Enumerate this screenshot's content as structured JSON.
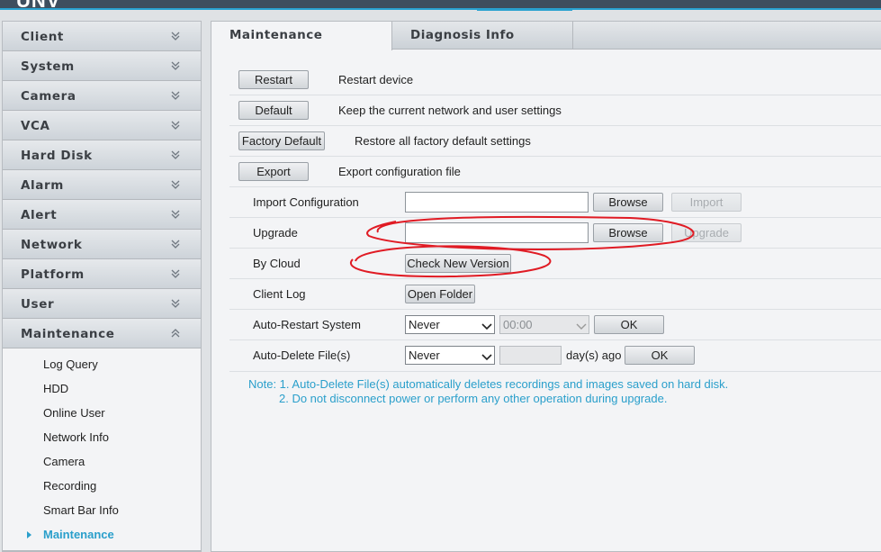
{
  "header": {
    "logo": "UNV",
    "accent_color": "#29a1cf",
    "bar_color": "#3e4e5e"
  },
  "sidebar": {
    "menus": [
      {
        "label": "Client",
        "expanded": false
      },
      {
        "label": "System",
        "expanded": false
      },
      {
        "label": "Camera",
        "expanded": false
      },
      {
        "label": "VCA",
        "expanded": false
      },
      {
        "label": "Hard Disk",
        "expanded": false
      },
      {
        "label": "Alarm",
        "expanded": false
      },
      {
        "label": "Alert",
        "expanded": false
      },
      {
        "label": "Network",
        "expanded": false
      },
      {
        "label": "Platform",
        "expanded": false
      },
      {
        "label": "User",
        "expanded": false
      },
      {
        "label": "Maintenance",
        "expanded": true
      }
    ],
    "sub_items": [
      {
        "label": "Log Query"
      },
      {
        "label": "HDD"
      },
      {
        "label": "Online User"
      },
      {
        "label": "Network Info"
      },
      {
        "label": "Camera"
      },
      {
        "label": "Recording"
      },
      {
        "label": "Smart Bar Info"
      },
      {
        "label": "Maintenance",
        "active": true
      }
    ]
  },
  "main": {
    "tabs": [
      {
        "label": "Maintenance",
        "active": true
      },
      {
        "label": "Diagnosis Info",
        "active": false
      }
    ],
    "actions": [
      {
        "button": "Restart",
        "description": "Restart device"
      },
      {
        "button": "Default",
        "description": "Keep the current network and user settings"
      },
      {
        "button": "Factory Default",
        "description": "Restore all factory default settings"
      },
      {
        "button": "Export",
        "description": "Export configuration file"
      }
    ],
    "import_config": {
      "label": "Import Configuration",
      "value": "",
      "browse": "Browse",
      "action": "Import"
    },
    "upgrade": {
      "label": "Upgrade",
      "value": "",
      "browse": "Browse",
      "action": "Upgrade"
    },
    "by_cloud": {
      "label": "By Cloud",
      "button": "Check New Version"
    },
    "client_log": {
      "label": "Client Log",
      "button": "Open Folder"
    },
    "auto_restart": {
      "label": "Auto-Restart System",
      "mode": "Never",
      "time": "00:00",
      "ok": "OK"
    },
    "auto_delete": {
      "label": "Auto-Delete File(s)",
      "mode": "Never",
      "days": "",
      "suffix": "day(s) ago",
      "ok": "OK"
    },
    "note": {
      "line1": "Note: 1. Auto-Delete File(s) automatically deletes recordings and images saved on hard disk.",
      "line2": "2. Do not disconnect power or perform any other operation during upgrade."
    }
  }
}
